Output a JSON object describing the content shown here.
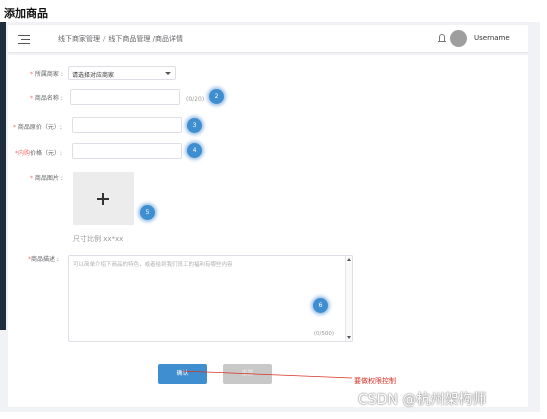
{
  "page": {
    "title": "添加商品"
  },
  "header": {
    "breadcrumb": [
      "线下商家管理",
      "线下商品管理 /商品详情"
    ],
    "breadcrumb_sep": "/",
    "username": "Username"
  },
  "form": {
    "merchant": {
      "required_mark": "* ",
      "label": "所属商家 :",
      "value": "请选择对应商家"
    },
    "name": {
      "required_mark": "* ",
      "label": "商品名称 :",
      "count": "(0/20)",
      "badge": "2"
    },
    "price": {
      "required_mark": "* ",
      "label": "商品原价（元）:",
      "badge": "3"
    },
    "inner_price": {
      "required_mark": "*",
      "label_red": "内购",
      "label_rest": "价格（元）:",
      "badge": "4"
    },
    "image": {
      "required_mark": "* ",
      "label": "商品图片 :",
      "hint": "尺寸比例 xx*xx",
      "badge": "5"
    },
    "desc": {
      "required_mark": "*",
      "label": "商品描述 :",
      "placeholder": "可以简单介绍下商品的特色，或者给到我们员工的福利有哪些内容",
      "count": "(0/500)",
      "badge": "6"
    },
    "buttons": {
      "confirm": "确认",
      "reset": "重置"
    }
  },
  "annotation": {
    "text": "要做权限控制",
    "color": "#d93025"
  },
  "watermark": {
    "text": "CSDN @杭州架构师"
  },
  "colors": {
    "primary": "#3e8ed0",
    "required": "#f56c6c",
    "sidebar": "#1f2d3d"
  }
}
